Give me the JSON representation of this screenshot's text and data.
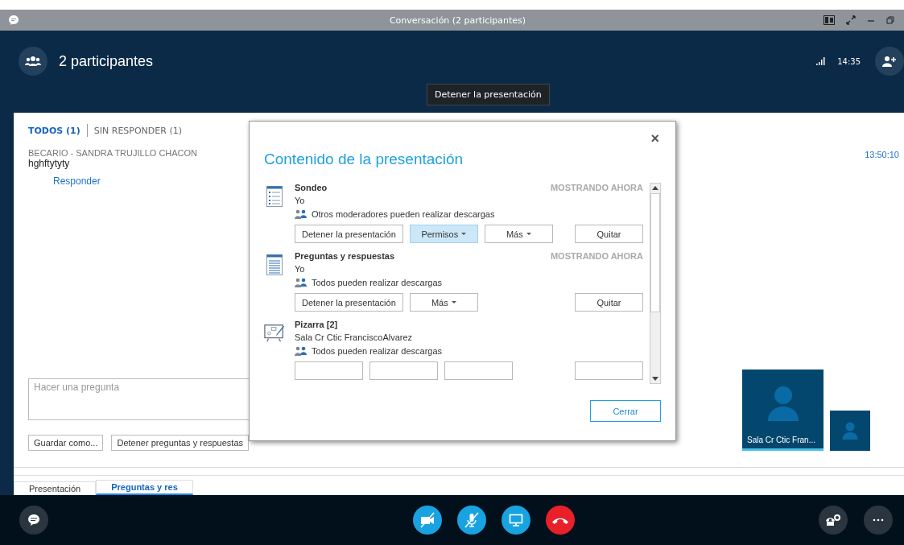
{
  "window": {
    "title": "Conversación (2 participantes)"
  },
  "header": {
    "title": "2 participantes",
    "time": "14:35"
  },
  "tooltip": "Detener la presentación",
  "qa": {
    "tabs": [
      {
        "label": "TODOS (1)",
        "selected": true
      },
      {
        "label": "SIN RESPONDER (1)",
        "selected": false
      }
    ],
    "question": {
      "author": "BECARIO - SANDRA TRUJILLO CHACON",
      "text": "hghftytyty",
      "reply": "Responder",
      "time": "13:50:10"
    },
    "input": {
      "placeholder": "Hacer una pregunta"
    },
    "buttons": [
      "Guardar como...",
      "Detener preguntas y respuestas"
    ]
  },
  "dialog": {
    "title": "Contenido de la presentación",
    "close": "×",
    "close_button": "Cerrar",
    "items": [
      {
        "kind": "poll",
        "title": "Sondeo",
        "owner": "Yo",
        "permission": "Otros moderadores pueden realizar descargas",
        "status": "MOSTRANDO AHORA",
        "buttons": [
          {
            "label": "Detener la presentación",
            "dropdown": false,
            "highlighted": false
          },
          {
            "label": "Permisos",
            "dropdown": true,
            "highlighted": true
          },
          {
            "label": "Más",
            "dropdown": true,
            "highlighted": false
          }
        ],
        "remove": "Quitar"
      },
      {
        "kind": "qa",
        "title": "Preguntas y respuestas",
        "owner": "Yo",
        "permission": "Todos pueden realizar descargas",
        "status": "MOSTRANDO AHORA",
        "buttons": [
          {
            "label": "Detener la presentación",
            "dropdown": false,
            "highlighted": false
          },
          {
            "label": "Más",
            "dropdown": true,
            "highlighted": false
          }
        ],
        "remove": "Quitar"
      },
      {
        "kind": "whiteboard",
        "title": "Pizarra [2]",
        "owner": "Sala Cr Ctic FranciscoAlvarez",
        "permission": "Todos pueden realizar descargas",
        "buttons": [
          {
            "highlighted": false
          },
          {
            "highlighted": false
          },
          {
            "highlighted": false
          }
        ]
      }
    ]
  },
  "participants": [
    {
      "kind": "tile",
      "name": "Sala Cr Ctic Fran...",
      "speaking": true
    },
    {
      "kind": "thumbnail",
      "speaking": false
    }
  ],
  "bottom_tabs": [
    {
      "label": "Presentación",
      "selected": false
    },
    {
      "label": "Preguntas y res",
      "selected": true
    }
  ],
  "controls": [
    {
      "kind": "camera",
      "off": true
    },
    {
      "kind": "mic",
      "off": true
    },
    {
      "kind": "screen"
    },
    {
      "kind": "hangup"
    }
  ]
}
